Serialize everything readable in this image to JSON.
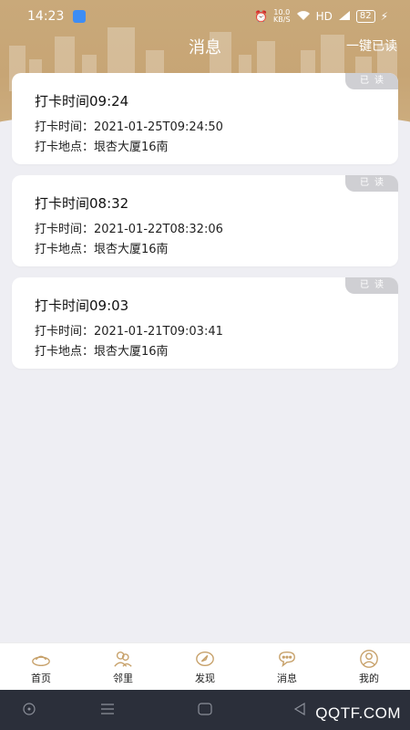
{
  "status_bar": {
    "time": "14:23",
    "network_speed_value": "10.0",
    "network_speed_unit": "KB/S",
    "hd": "HD",
    "battery": "82"
  },
  "header": {
    "title": "消息",
    "read_all": "一键已读"
  },
  "messages": [
    {
      "badge": "已读",
      "title": "打卡时间09:24",
      "time_label": "打卡时间：2021-01-25T09:24:50",
      "place_label": "打卡地点：垠杏大厦16南"
    },
    {
      "badge": "已读",
      "title": "打卡时间08:32",
      "time_label": "打卡时间：2021-01-22T08:32:06",
      "place_label": "打卡地点：垠杏大厦16南"
    },
    {
      "badge": "已读",
      "title": "打卡时间09:03",
      "time_label": "打卡时间：2021-01-21T09:03:41",
      "place_label": "打卡地点：垠杏大厦16南"
    }
  ],
  "tabbar": {
    "items": [
      {
        "label": "首页",
        "icon": "home-ingot-icon"
      },
      {
        "label": "邻里",
        "icon": "neighbors-icon"
      },
      {
        "label": "发现",
        "icon": "discover-compass-icon"
      },
      {
        "label": "消息",
        "icon": "message-bubble-icon"
      },
      {
        "label": "我的",
        "icon": "profile-icon"
      }
    ]
  },
  "watermark": "QQTF.COM",
  "colors": {
    "header": "#c9a97a",
    "tab_icon": "#c7a16a",
    "badge": "#cfcfd3",
    "background": "#eeeef3"
  }
}
